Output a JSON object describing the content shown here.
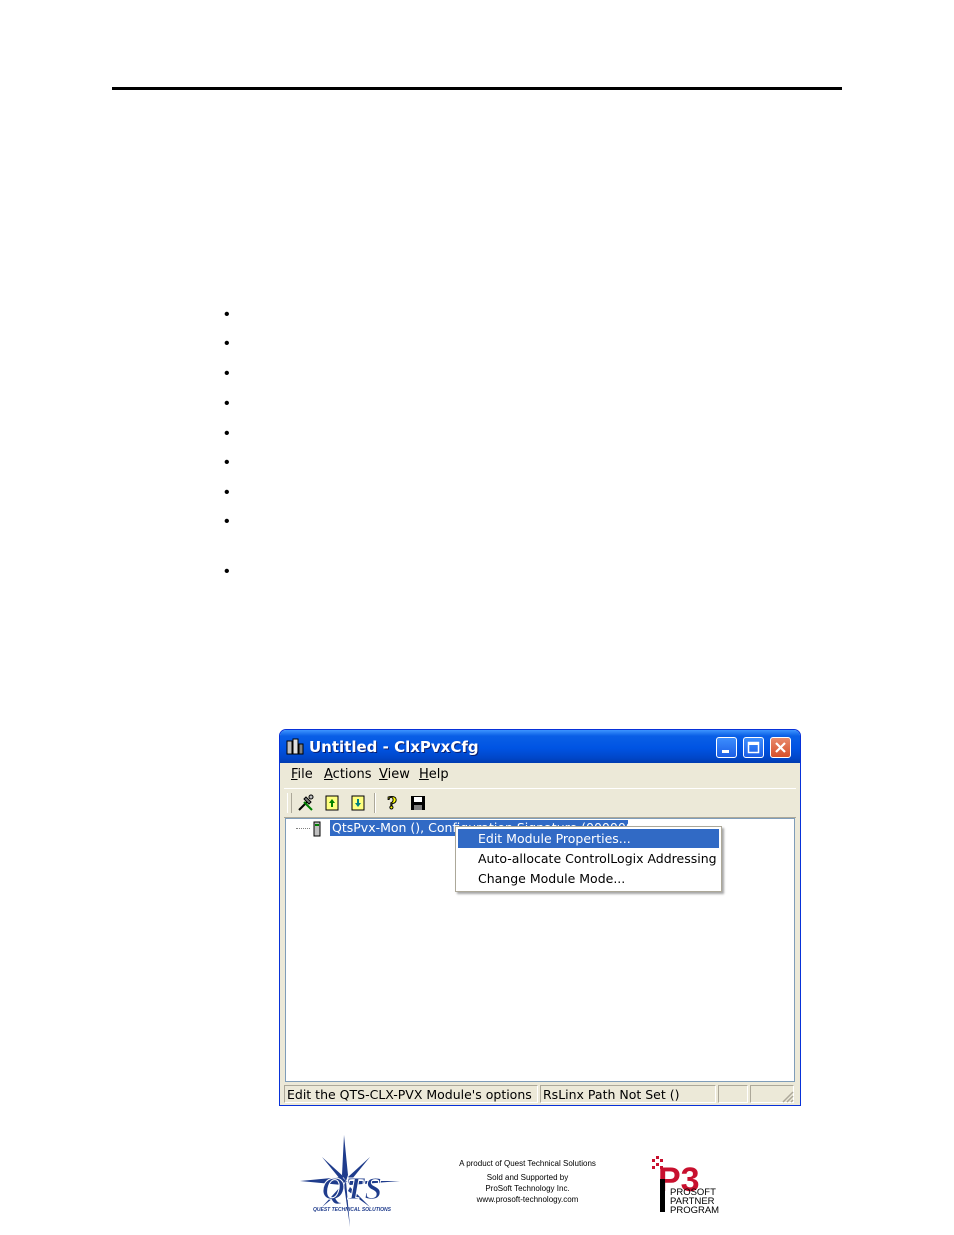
{
  "window": {
    "title": "Untitled - ClxPvxCfg",
    "menu": [
      {
        "label": "File",
        "underline": "F",
        "rest": "ile"
      },
      {
        "label": "Actions",
        "underline": "A",
        "rest": "ctions"
      },
      {
        "label": "View",
        "underline": "V",
        "rest": "iew"
      },
      {
        "label": "Help",
        "underline": "H",
        "rest": "elp"
      }
    ],
    "toolbar_icons": [
      "tools-icon",
      "upload-icon",
      "download-icon",
      "help-icon",
      "save-icon"
    ],
    "tree": {
      "item_label": "QtsPvx-Mon (), Configuration Signature (00000000)"
    },
    "context_menu": [
      {
        "label": "Edit Module Properties...",
        "selected": true
      },
      {
        "label": "Auto-allocate ControlLogix Addressing",
        "selected": false
      },
      {
        "label": "Change Module Mode...",
        "selected": false
      }
    ],
    "status": {
      "left": "Edit the QTS-CLX-PVX Module's options",
      "right": "RsLinx Path Not Set ()"
    }
  },
  "footer": {
    "line1": "A product of Quest Technical Solutions",
    "line2": "Sold and Supported by",
    "line3": "ProSoft Technology Inc.",
    "line4": "www.prosoft-technology.com",
    "qts_logo_text": "QTS",
    "qts_logo_sub": "QUEST TECHNICAL SOLUTIONS",
    "p3_title": "P3",
    "p3_lines": [
      "PROSOFT",
      "PARTNER",
      "PROGRAM"
    ]
  },
  "colors": {
    "title_bar": "#0054e3",
    "selection": "#316ac5",
    "qts_blue": "#1f3c8c",
    "p3_red": "#c8102e"
  }
}
